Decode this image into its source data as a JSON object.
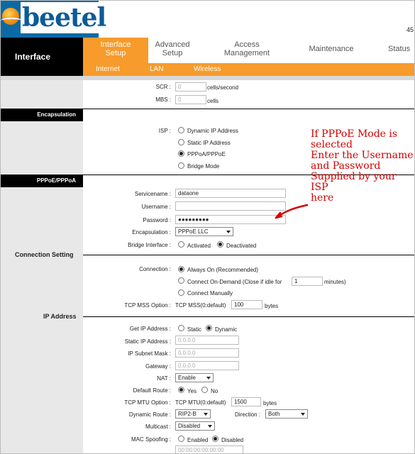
{
  "brand": {
    "logo_text": "beetel",
    "model_fragment": "45"
  },
  "nav": {
    "section_title": "Interface",
    "tabs": [
      {
        "label": "Interface Setup"
      },
      {
        "label": "Advanced Setup"
      },
      {
        "label": "Access Management"
      },
      {
        "label": "Maintenance"
      },
      {
        "label": "Status"
      }
    ],
    "subtabs": [
      "Internet",
      "LAN",
      "Wireless"
    ]
  },
  "sections": {
    "encapsulation": "Encapsulation",
    "pppoe": "PPPoE/PPPoA",
    "connection_setting": "Connection Setting",
    "ip_address": "IP Address"
  },
  "qos": {
    "scr_label": "SCR :",
    "scr_value": "0",
    "scr_unit": "cells/second",
    "mbs_label": "MBS :",
    "mbs_value": "0",
    "mbs_unit": "cells"
  },
  "isp": {
    "label": "ISP :",
    "options": [
      "Dynamic IP Address",
      "Static IP Address",
      "PPPoA/PPPoE",
      "Bridge Mode"
    ],
    "selected": "PPPoA/PPPoE"
  },
  "pppoe": {
    "servicename_label": "Servicename :",
    "servicename": "dataone",
    "username_label": "Username :",
    "username": "",
    "password_label": "Password :",
    "password": "●●●●●●●●●",
    "encapsulation_label": "Encapsulation :",
    "encapsulation": "PPPoE LLC",
    "bridge_label": "Bridge Interface :",
    "bridge_activated": "Activated",
    "bridge_deactivated": "Deactivated"
  },
  "connection": {
    "label": "Connection :",
    "always_on": "Always On (Recommended)",
    "on_demand_prefix": "Connect On-Demand (Close if idle for",
    "on_demand_value": "1",
    "on_demand_suffix": "minutes)",
    "manual": "Connect Manually",
    "mss_label": "TCP MSS Option :",
    "mss_text": "TCP MSS(0:default)",
    "mss_value": "100",
    "mss_unit": "bytes"
  },
  "ip": {
    "get_ip_label": "Get IP Address :",
    "get_static": "Static",
    "get_dynamic": "Dynamic",
    "static_ip_label": "Static IP Address :",
    "static_ip": "0.0.0.0",
    "subnet_label": "IP Subnet Mask :",
    "subnet": "0.0.0.0",
    "gateway_label": "Gateway :",
    "gateway": "0.0.0.0",
    "nat_label": "NAT :",
    "nat": "Enable",
    "default_route_label": "Default Route :",
    "yes": "Yes",
    "no": "No",
    "mtu_label": "TCP MTU Option :",
    "mtu_text": "TCP MTU(0:default)",
    "mtu_value": "1500",
    "mtu_unit": "bytes",
    "dynamic_route_label": "Dynamic Route :",
    "dynamic_route": "RIP2-B",
    "direction_label": "Direction :",
    "direction": "Both",
    "multicast_label": "Multicast :",
    "multicast": "Disabled",
    "mac_spoof_label": "MAC Spoofing :",
    "mac_enabled": "Enabled",
    "mac_disabled": "Disabled",
    "mac_value": "00:00:00:00:00:00"
  },
  "annotation": {
    "lines": [
      "If PPPoE Mode is selected",
      "Enter the Username and Password",
      "Supplied by your ISP",
      "here"
    ],
    "color": "#d40000"
  },
  "colors": {
    "accent": "#f79b2c",
    "brand_blue": "#0b6aa6",
    "nav_black": "#000000"
  }
}
